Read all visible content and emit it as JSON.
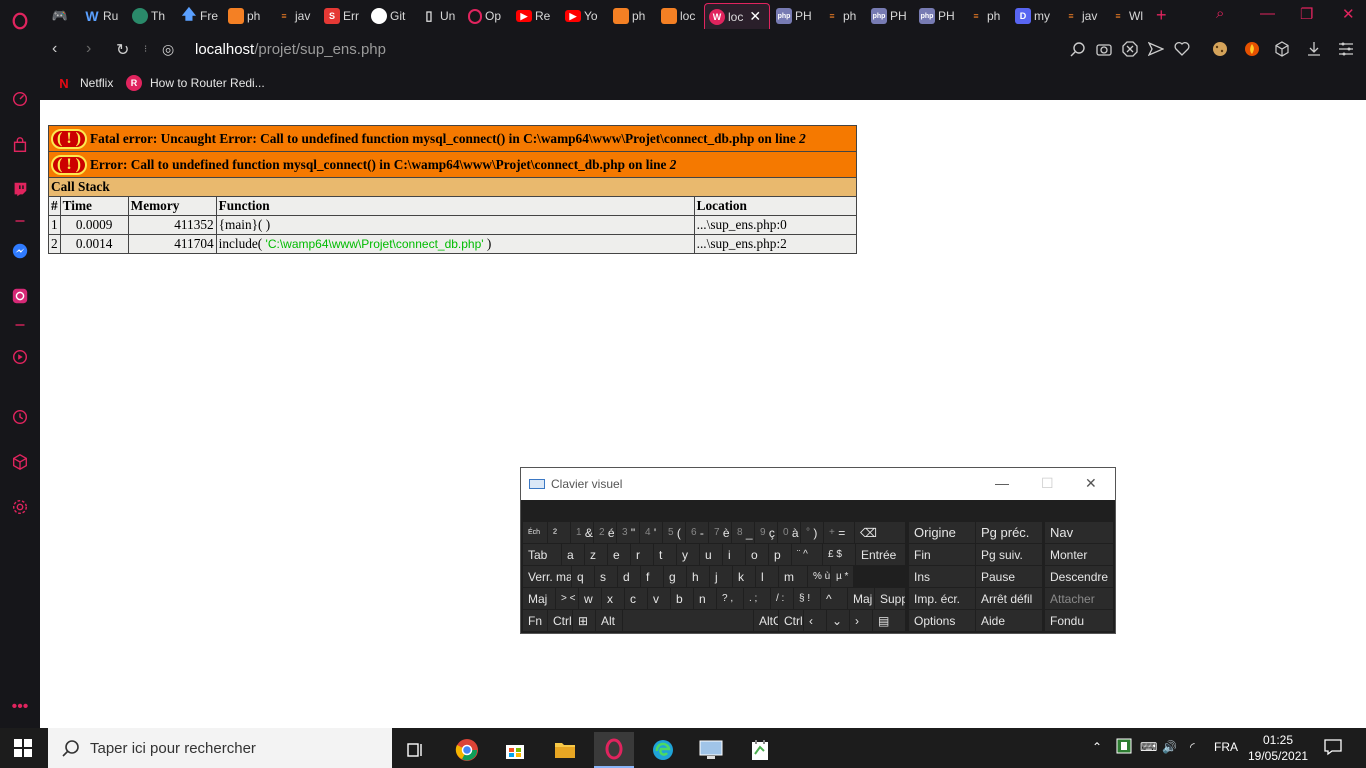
{
  "browser": {
    "tabs": [
      {
        "label": "",
        "icon": "gamepad-icon"
      },
      {
        "label": "Ru",
        "icon": "w-icon"
      },
      {
        "label": "Th",
        "icon": "globe-icon"
      },
      {
        "label": "Fre",
        "icon": "arrow-up-icon"
      },
      {
        "label": "ph",
        "icon": "xampp-icon"
      },
      {
        "label": "jav",
        "icon": "stack-icon"
      },
      {
        "label": "Err",
        "icon": "s-icon"
      },
      {
        "label": "Git",
        "icon": "github-icon"
      },
      {
        "label": "Un",
        "icon": "doc-icon"
      },
      {
        "label": "Op",
        "icon": "opera-icon"
      },
      {
        "label": "Re",
        "icon": "youtube-icon"
      },
      {
        "label": "Yo",
        "icon": "youtube-icon"
      },
      {
        "label": "ph",
        "icon": "xampp-icon"
      },
      {
        "label": "loc",
        "icon": "xampp-icon"
      },
      {
        "label": "loc",
        "icon": "wamp-icon",
        "active": true
      },
      {
        "label": "PH",
        "icon": "php-icon"
      },
      {
        "label": "ph",
        "icon": "stack-icon"
      },
      {
        "label": "PH",
        "icon": "php-icon"
      },
      {
        "label": "PH",
        "icon": "php-icon"
      },
      {
        "label": "ph",
        "icon": "stack-icon"
      },
      {
        "label": "my",
        "icon": "d-icon"
      },
      {
        "label": "jav",
        "icon": "stack-icon"
      },
      {
        "label": "Wl",
        "icon": "stack-icon"
      }
    ],
    "url_host": "localhost",
    "url_path": "/projet/sup_ens.php",
    "bookmarks": [
      {
        "label": "Netflix"
      },
      {
        "label": "How to Router Redi..."
      }
    ]
  },
  "error_page": {
    "fatal": "Fatal error: Uncaught Error: Call to undefined function mysql_connect() in C:\\wamp64\\www\\Projet\\connect_db.php on line ",
    "fatal_line": "2",
    "error": "Error: Call to undefined function mysql_connect() in C:\\wamp64\\www\\Projet\\connect_db.php on line ",
    "error_line": "2",
    "badge": "( ! )",
    "call_stack_title": "Call Stack",
    "columns": [
      "#",
      "Time",
      "Memory",
      "Function",
      "Location"
    ],
    "rows": [
      {
        "n": "1",
        "time": "0.0009",
        "memory": "411352",
        "function": "{main}( )",
        "function_arg": "",
        "function_tail": "",
        "location": "...\\sup_ens.php:0"
      },
      {
        "n": "2",
        "time": "0.0014",
        "memory": "411704",
        "function": "include( ",
        "function_arg": "'C:\\wamp64\\www\\Projet\\connect_db.php'",
        "function_tail": " )",
        "location": "...\\sup_ens.php:2"
      }
    ]
  },
  "osk": {
    "title": "Clavier visuel",
    "keys": {
      "esc": "Éch",
      "sup2": "²",
      "k1a": "1",
      "k1b": "&",
      "k2a": "2",
      "k2b": "é",
      "k3a": "3",
      "k3b": "\"",
      "k4a": "4",
      "k4b": "'",
      "k5a": "5",
      "k5b": "(",
      "k6a": "6",
      "k6b": "-",
      "k7a": "7",
      "k7b": "è",
      "k8a": "8",
      "k8b": "_",
      "k9a": "9",
      "k9b": "ç",
      "k0a": "0",
      "k0b": "à",
      "degA": "°",
      "degB": ")",
      "plusA": "+",
      "plusB": "=",
      "tab": "Tab",
      "a": "a",
      "z": "z",
      "e": "e",
      "r": "r",
      "t": "t",
      "y": "y",
      "u": "u",
      "i": "i",
      "o": "o",
      "p": "p",
      "hat": "¨ ^",
      "pound": "£ $",
      "enter": "Entrée",
      "caps": "Verr. maj",
      "q": "q",
      "s": "s",
      "d": "d",
      "f": "f",
      "g": "g",
      "h": "h",
      "j": "j",
      "k": "k",
      "l": "l",
      "m": "m",
      "pct": "% ù",
      "mu": "µ *",
      "shift": "Maj",
      "lt": "> <",
      "w": "w",
      "x": "x",
      "c": "c",
      "v": "v",
      "b": "b",
      "n": "n",
      "q1": "? ,",
      "q2": ". ;",
      "q3": "/ :",
      "q4": "§ !",
      "up": "^",
      "shift2": "Maj",
      "del": "Suppr",
      "fn": "Fn",
      "ctrl": "Ctrl",
      "alt": "Alt",
      "altgr": "AltGr",
      "ctrl2": "Ctrl",
      "home": "Origine",
      "pgup": "Pg préc.",
      "nav": "Nav",
      "end": "Fin",
      "pgdn": "Pg suiv.",
      "up2": "Monter",
      "ins": "Ins",
      "pause": "Pause",
      "down2": "Descendre",
      "prt": "Imp. écr.",
      "scroll": "Arrêt défil",
      "dock": "Attacher",
      "options": "Options",
      "help": "Aide",
      "fade": "Fondu"
    }
  },
  "taskbar": {
    "search_placeholder": "Taper ici pour rechercher",
    "lang": "FRA",
    "time": "01:25",
    "date": "19/05/2021"
  },
  "colors": {
    "accent": "#e0245e",
    "xdebug_error": "#f57900",
    "xdebug_callstack": "#e9b96e",
    "xdebug_row": "#eeeeec"
  }
}
